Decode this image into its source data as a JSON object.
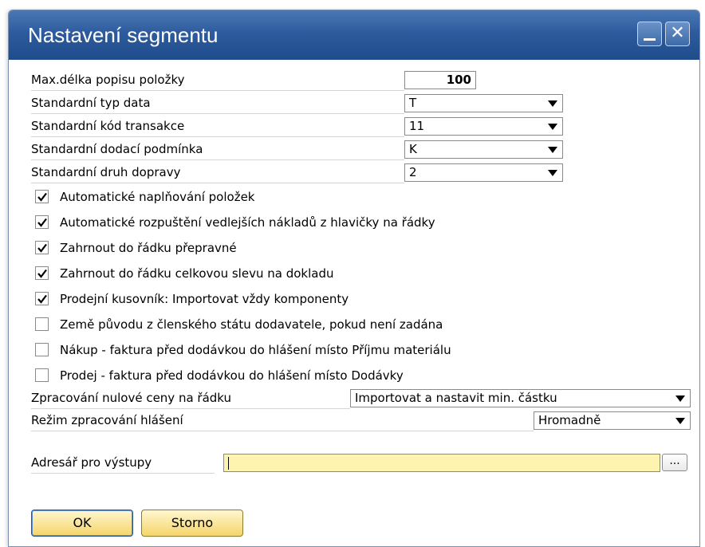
{
  "window": {
    "title": "Nastavení segmentu"
  },
  "fields": {
    "max_desc_label": "Max.délka popisu položky",
    "max_desc_value": "100",
    "date_type_label": "Standardní typ data",
    "date_type_value": "T",
    "transaction_label": "Standardní kód transakce",
    "transaction_value": "11",
    "delivery_label": "Standardní dodací podmínka",
    "delivery_value": "K",
    "transport_label": "Standardní druh dopravy",
    "transport_value": "2"
  },
  "checkboxes": [
    {
      "label": "Automatické naplňování položek",
      "checked": true
    },
    {
      "label": "Automatické rozpuštění vedlejších nákladů z hlavičky na řádky",
      "checked": true
    },
    {
      "label": "Zahrnout do řádku přepravné",
      "checked": true
    },
    {
      "label": "Zahrnout do řádku celkovou slevu na dokladu",
      "checked": true
    },
    {
      "label": "Prodejní kusovník: Importovat vždy komponenty",
      "checked": true
    },
    {
      "label": "Země původu z členského státu dodavatele, pokud není zadána",
      "checked": false
    },
    {
      "label": "Nákup - faktura před dodávkou do hlášení místo Příjmu materiálu",
      "checked": false
    },
    {
      "label": "Prodej - faktura před dodávkou do hlášení místo Dodávky",
      "checked": false
    }
  ],
  "zero_price": {
    "label": "Zpracování nulové ceny na řádku",
    "value": "Importovat a nastavit min. částku"
  },
  "report_mode": {
    "label": "Režim zpracování hlášení",
    "value": "Hromadně"
  },
  "output_dir": {
    "label": "Adresář pro výstupy",
    "value": "",
    "browse_label": "..."
  },
  "buttons": {
    "ok": "OK",
    "cancel": "Storno"
  }
}
